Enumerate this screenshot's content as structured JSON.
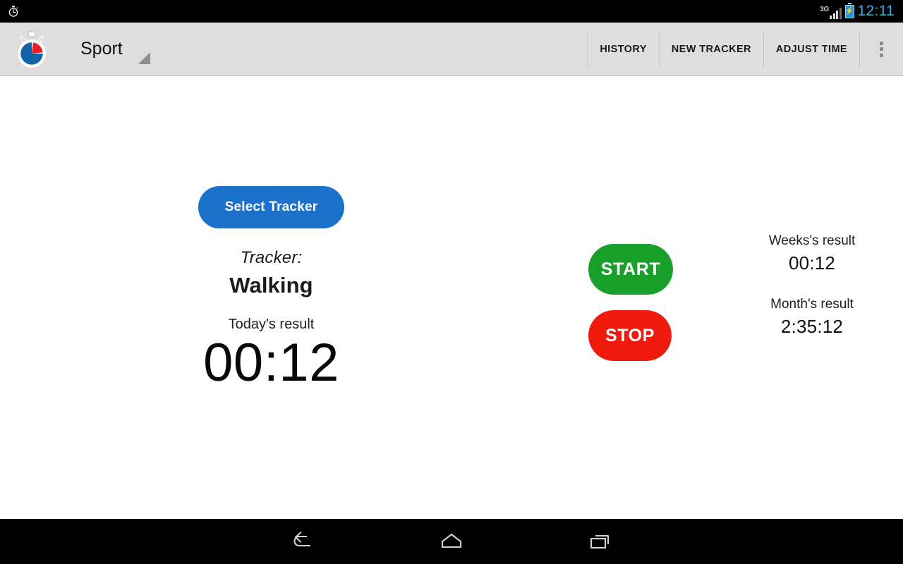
{
  "status_bar": {
    "notification_icon": "stopwatch-icon",
    "network_type": "3G",
    "signal_icon": "signal-bars-icon",
    "battery_icon": "battery-charging-icon",
    "clock": "12:11",
    "clock_color": "#3ab0e8"
  },
  "action_bar": {
    "app_icon": "stopwatch-pie-icon",
    "title": "Sport",
    "spinner_icon": "dropdown-caret-icon",
    "actions": [
      {
        "label": "HISTORY",
        "name": "history"
      },
      {
        "label": "NEW TRACKER",
        "name": "new-tracker"
      },
      {
        "label": "ADJUST TIME",
        "name": "adjust-time"
      }
    ],
    "overflow_icon": "overflow-menu-icon",
    "background_color": "#dedede"
  },
  "main": {
    "select_tracker_button": {
      "label": "Select Tracker",
      "color": "#1b72ca"
    },
    "tracker": {
      "label": "Tracker:",
      "name": "Walking"
    },
    "today": {
      "label": "Today's result",
      "value": "00:12"
    },
    "controls": {
      "start_label": "START",
      "start_color": "#19a02b",
      "stop_label": "STOP",
      "stop_color": "#f01a0d"
    },
    "results": [
      {
        "label": "Weeks's result",
        "value": "00:12"
      },
      {
        "label": "Month's result",
        "value": "2:35:12"
      }
    ]
  },
  "nav_bar": {
    "back_icon": "back-arrow-icon",
    "home_icon": "home-icon",
    "recents_icon": "recent-apps-icon"
  }
}
